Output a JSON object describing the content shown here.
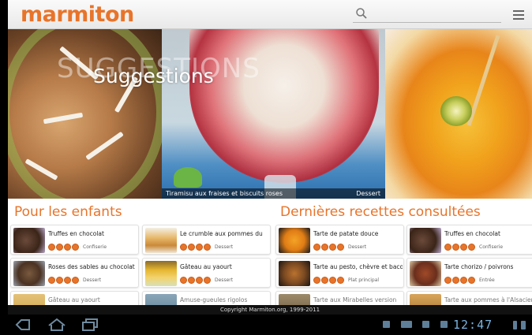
{
  "header": {
    "logo": "marmiton",
    "search_placeholder": ""
  },
  "hero": {
    "ghost_text": "SUGGESTIONS",
    "title": "Suggestions",
    "caption": "Tiramisu aux fraises et biscuits roses",
    "caption_category": "Dessert"
  },
  "sections": {
    "left_title": "Pour les enfants",
    "right_title": "Dernières recettes consultées"
  },
  "cards": [
    {
      "title": "Truffes en chocolat",
      "category": "Confiserie"
    },
    {
      "title": "Le crumble aux pommes du",
      "category": "Dessert"
    },
    {
      "title": "Tarte de patate douce",
      "category": "Dessert"
    },
    {
      "title": "Truffes en chocolat",
      "category": "Confiserie"
    },
    {
      "title": "Roses des sables au chocolat",
      "category": "Dessert"
    },
    {
      "title": "Gâteau au yaourt",
      "category": "Dessert"
    },
    {
      "title": "Tarte au pesto, chèvre et bacon",
      "category": "Plat principal"
    },
    {
      "title": "Tarte chorizo / poivrons",
      "category": "Entrée"
    },
    {
      "title": "Gâteau au yaourt",
      "category": ""
    },
    {
      "title": "Amuse-gueules rigolos",
      "category": ""
    },
    {
      "title": "Tarte aux Mirabelles version",
      "category": ""
    },
    {
      "title": "Tarte aux pommes à l'Alsacienne",
      "category": ""
    }
  ],
  "footer": {
    "copyright": "Copyright Marmiton.org, 1999-2011"
  },
  "system": {
    "clock": "12:47"
  },
  "colors": {
    "brand": "#e8742a"
  }
}
